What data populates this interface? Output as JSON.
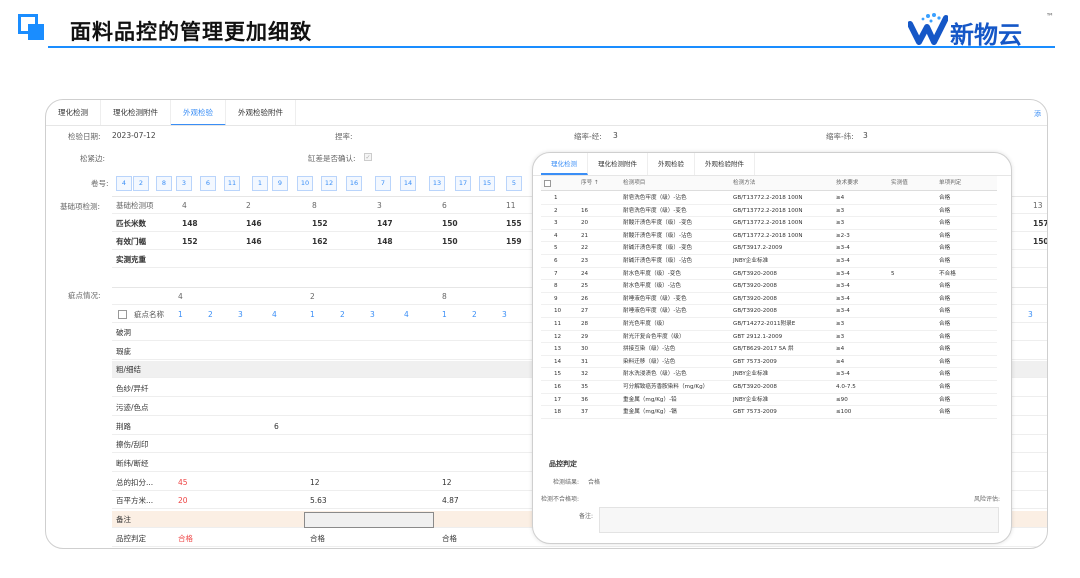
{
  "header": {
    "title": "面料品控的管理更加细致",
    "logo_text": "新物云",
    "logo_tm": "™",
    "accent": "#1a8dff"
  },
  "win1": {
    "tabs": [
      "理化检测",
      "理化检测附件",
      "外观检验",
      "外观检验附件"
    ],
    "active_tab": 2,
    "edge_link": "添",
    "form": {
      "inspect_date_label": "检验日期:",
      "inspect_date": "2023-07-12",
      "shrink_label": "捏率:",
      "warp_label": "缩率-经:",
      "warp": "3",
      "weft_label": "缩率-纬:",
      "weft": "3",
      "tight_label": "松紧边:",
      "vat_label": "缸差是否确认:",
      "vat_check": "✓",
      "roll_label": "卷号:",
      "basic_label": "基础项检测:",
      "defect_label": "疵点情况:"
    },
    "rolls": [
      "4",
      "2",
      "8",
      "3",
      "6",
      "11",
      "1",
      "9",
      "10",
      "12",
      "16",
      "7",
      "14",
      "13",
      "17",
      "15",
      "5"
    ],
    "basic": {
      "header": [
        "基础检测项",
        "4",
        "2",
        "8",
        "3",
        "6",
        "11",
        "13"
      ],
      "rows": [
        {
          "name": "匹长米数",
          "vals": [
            "148",
            "146",
            "152",
            "147",
            "150",
            "155",
            "157"
          ]
        },
        {
          "name": "有效门幅",
          "vals": [
            "152",
            "146",
            "162",
            "148",
            "150",
            "159",
            "150"
          ]
        },
        {
          "name": "实测克重",
          "vals": [
            "",
            "",
            "",
            "",
            "",
            "",
            ""
          ]
        }
      ]
    },
    "defect": {
      "top_nums": [
        "4",
        "2",
        "8"
      ],
      "name_header": "疵点名称",
      "sub_nums": [
        "1",
        "2",
        "3",
        "4",
        "1",
        "2",
        "3",
        "4",
        "1",
        "2",
        "3",
        "3"
      ],
      "rows": [
        {
          "name": "破洞",
          "v1": "",
          "v2": "",
          "v3": ""
        },
        {
          "name": "瑕疵",
          "v1": "",
          "v2": "",
          "v3": ""
        },
        {
          "name": "粗/细结",
          "v1": "",
          "v2": "",
          "v3": ""
        },
        {
          "name": "色纱/异纤",
          "v1": "",
          "v2": "",
          "v3": ""
        },
        {
          "name": "污迹/色点",
          "v1": "",
          "v2": "",
          "v3": ""
        },
        {
          "name": "荆路",
          "v1": "6",
          "v2": "",
          "v3": ""
        },
        {
          "name": "擦伤/刮印",
          "v1": "",
          "v2": "",
          "v3": ""
        },
        {
          "name": "断纬/断经",
          "v1": "",
          "v2": "",
          "v3": ""
        },
        {
          "name": "总的扣分...",
          "v1": "45",
          "v2": "12",
          "v3": "12"
        },
        {
          "name": "百平方米...",
          "v1": "20",
          "v2": "5.63",
          "v3": "4.87"
        },
        {
          "name": "备注",
          "v1": "",
          "v2": "",
          "v3": ""
        },
        {
          "name": "品控判定",
          "v1": "合格",
          "v2": "合格",
          "v3": "合格"
        }
      ]
    }
  },
  "win2": {
    "tabs": [
      "理化检测",
      "理化检测附件",
      "外观检验",
      "外观检验附件"
    ],
    "active_tab": 0,
    "headers": [
      "序号 ↑",
      "检测项目",
      "检测方法",
      "技术要求",
      "实测值",
      "单项判定"
    ],
    "rows": [
      [
        "1",
        "",
        "耐皂洗色牢度（级）-沾色",
        "GB/T13772.2-2018 100N",
        "≥4",
        "",
        "合格"
      ],
      [
        "2",
        "16",
        "耐皂洗色牢度（级）-变色",
        "GB/T13772.2-2018 100N",
        "≥3",
        "",
        "合格"
      ],
      [
        "3",
        "20",
        "耐酸汗渍色牢度（级）-变色",
        "GB/T13772.2-2018 100N",
        "≥3",
        "",
        "合格"
      ],
      [
        "4",
        "21",
        "耐酸汗渍色牢度（级）-沾色",
        "GB/T13772.2-2018 100N",
        "≥2-3",
        "",
        "合格"
      ],
      [
        "5",
        "22",
        "耐碱汗渍色牢度（级）-变色",
        "GB/T3917.2-2009",
        "≥3-4",
        "",
        "合格"
      ],
      [
        "6",
        "23",
        "耐碱汗渍色牢度（级）-沾色",
        "JNBY企业标准",
        "≥3-4",
        "",
        "合格"
      ],
      [
        "7",
        "24",
        "耐水色牢度（级）-变色",
        "GB/T3920-2008",
        "≥3-4",
        "5",
        "不合格"
      ],
      [
        "8",
        "25",
        "耐水色牢度（级）-沾色",
        "GB/T3920-2008",
        "≥3-4",
        "",
        "合格"
      ],
      [
        "9",
        "26",
        "耐唾液色牢度（级）-变色",
        "GB/T3920-2008",
        "≥3-4",
        "",
        "合格"
      ],
      [
        "10",
        "27",
        "耐唾液色牢度（级）-沾色",
        "GB/T3920-2008",
        "≥3-4",
        "",
        "合格"
      ],
      [
        "11",
        "28",
        "耐光色牢度（级）",
        "GB/T14272-2011附录E",
        "≥3",
        "",
        "合格"
      ],
      [
        "12",
        "29",
        "耐光汗复合色牢度（级）",
        "GBT 2912.1-2009",
        "≥3",
        "",
        "合格"
      ],
      [
        "13",
        "30",
        "拼接互染（级）-沾色",
        "GB/T8629-2017 5A 烘",
        "≥4",
        "",
        "合格"
      ],
      [
        "14",
        "31",
        "染料迁移（级）-沾色",
        "GBT 7573-2009",
        "≥4",
        "",
        "合格"
      ],
      [
        "15",
        "32",
        "耐水洗浸渍色（级）-沾色",
        "JNBY企业标准",
        "≥3-4",
        "",
        "合格"
      ],
      [
        "16",
        "35",
        "可分解致癌芳香胺染料（mg/Kg）",
        "GB/T3920-2008",
        "4.0-7.5",
        "",
        "合格"
      ],
      [
        "17",
        "36",
        "重金属（mg/Kg）-铅",
        "JNBY企业标准",
        "≤90",
        "",
        "合格"
      ],
      [
        "18",
        "37",
        "重金属（mg/Kg）-镉",
        "GBT 7573-2009",
        "≤100",
        "",
        "合格"
      ]
    ],
    "qc_section": "品控判定",
    "result_label": "检测结果:",
    "result_value": "合格",
    "fail_label": "检测不合格项:",
    "risk_label": "风险评估:",
    "note_label": "备注:"
  }
}
